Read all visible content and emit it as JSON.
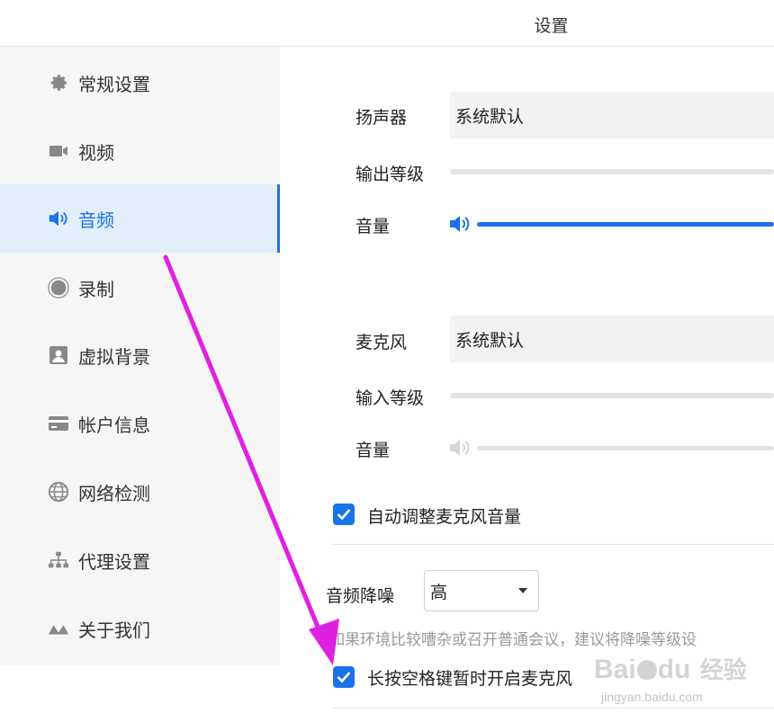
{
  "window": {
    "title": "设置"
  },
  "sidebar": {
    "items": [
      {
        "label": "常规设置",
        "icon": "gear-icon"
      },
      {
        "label": "视频",
        "icon": "video-camera-icon"
      },
      {
        "label": "音频",
        "icon": "speaker-icon",
        "active": true
      },
      {
        "label": "录制",
        "icon": "record-icon"
      },
      {
        "label": "虚拟背景",
        "icon": "portrait-icon"
      },
      {
        "label": "帐户信息",
        "icon": "card-icon"
      },
      {
        "label": "网络检测",
        "icon": "globe-icon"
      },
      {
        "label": "代理设置",
        "icon": "network-tree-icon"
      },
      {
        "label": "关于我们",
        "icon": "logo-wave-icon"
      }
    ]
  },
  "audio": {
    "speaker": {
      "label": "扬声器",
      "value": "系统默认",
      "output_level_label": "输出等级",
      "volume_label": "音量",
      "volume_level": 1.0
    },
    "microphone": {
      "label": "麦克风",
      "value": "系统默认",
      "input_level_label": "输入等级",
      "volume_label": "音量",
      "volume_level": 0.0
    },
    "auto_adjust": {
      "label": "自动调整麦克风音量",
      "checked": true
    },
    "noise": {
      "label": "音频降噪",
      "selected": "高",
      "hint": "如果环境比较嘈杂或召开普通会议，建议将降噪等级设"
    },
    "push_to_talk": {
      "label": "长按空格键暂时开启麦克风",
      "checked": true
    }
  },
  "watermark": {
    "text_main": "Bai",
    "text_paw": "du",
    "text_cn": "经验",
    "url": "jingyan.baidu.com"
  },
  "colors": {
    "accent": "#1a73e8",
    "arrow": "#e020e0",
    "sidebar_bg": "#f6f6f6",
    "active_bg": "#e3eefb"
  }
}
